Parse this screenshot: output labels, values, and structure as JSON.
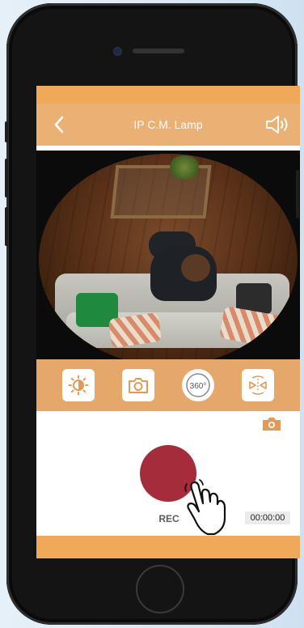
{
  "header": {
    "title": "IP C.M. Lamp",
    "back_icon": "chevron-left-icon",
    "sound_icon": "speaker-icon"
  },
  "controls": [
    {
      "name": "brightness-icon"
    },
    {
      "name": "camera-icon"
    },
    {
      "name": "360-icon",
      "label": "360°"
    },
    {
      "name": "flip-icon"
    }
  ],
  "snapshot_icon": "camera-icon",
  "record": {
    "label": "REC",
    "timer": "00:00:00"
  },
  "colors": {
    "header": "#eab074",
    "strip": "#f0a859",
    "controls_bar": "#e6a86a",
    "rec_button": "#a52c3a"
  }
}
